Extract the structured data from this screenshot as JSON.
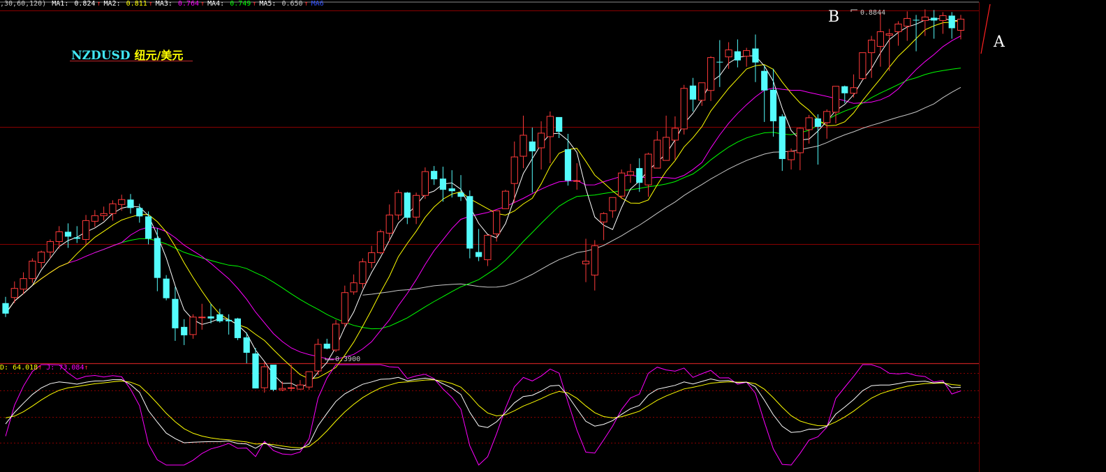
{
  "header": {
    "params": ",30,60,120)",
    "ma": [
      {
        "label": "MA1:",
        "value": "0.824",
        "arrow": "↑",
        "color": "#ffffff"
      },
      {
        "label": "MA2:",
        "value": "0.811",
        "arrow": "↑",
        "color": "#ffff00"
      },
      {
        "label": "MA3:",
        "value": "0.764",
        "arrow": "↑",
        "color": "#ff00ff"
      },
      {
        "label": "MA4:",
        "value": "0.749",
        "arrow": "↑",
        "color": "#00ff00"
      },
      {
        "label": "MA5:",
        "value": "0.650",
        "arrow": "↑",
        "color": "#c8c8c8"
      },
      {
        "label": "MA6",
        "value": "",
        "arrow": "",
        "color": "#3050ff"
      }
    ]
  },
  "title": {
    "symbol": "NZDUSD",
    "name": "纽元/美元"
  },
  "annotations": {
    "a": "A",
    "b": "B",
    "high": "0.8844",
    "low": "0.3900"
  },
  "kdj": {
    "d_label": "D:",
    "d_value": "64.018",
    "d_arrow": "↑",
    "j_label": "J:",
    "j_value": "73.084",
    "j_arrow": "↑"
  },
  "colors": {
    "up": "#ff3a3a",
    "down": "#54fcfc",
    "ma1": "#ffffff",
    "ma2": "#ffff00",
    "ma3": "#ff00ff",
    "ma4": "#00ff00",
    "ma5": "#c8c8c8",
    "grid": "#8a0000"
  },
  "chart_data": {
    "type": "candlestick",
    "title": "NZDUSD 纽元/美元",
    "ylim": [
      0.39,
      0.8844
    ],
    "candles": [
      [
        0.468,
        0.477,
        0.448,
        0.453
      ],
      [
        0.476,
        0.499,
        0.468,
        0.489
      ],
      [
        0.488,
        0.512,
        0.481,
        0.503
      ],
      [
        0.503,
        0.532,
        0.497,
        0.528
      ],
      [
        0.526,
        0.543,
        0.518,
        0.541
      ],
      [
        0.541,
        0.559,
        0.532,
        0.556
      ],
      [
        0.556,
        0.578,
        0.546,
        0.57
      ],
      [
        0.57,
        0.582,
        0.547,
        0.563
      ],
      [
        0.562,
        0.578,
        0.554,
        0.56
      ],
      [
        0.559,
        0.594,
        0.552,
        0.586
      ],
      [
        0.585,
        0.601,
        0.577,
        0.593
      ],
      [
        0.593,
        0.606,
        0.586,
        0.596
      ],
      [
        0.596,
        0.615,
        0.586,
        0.61
      ],
      [
        0.609,
        0.623,
        0.6,
        0.616
      ],
      [
        0.616,
        0.624,
        0.596,
        0.604
      ],
      [
        0.604,
        0.61,
        0.583,
        0.592
      ],
      [
        0.592,
        0.599,
        0.552,
        0.56
      ],
      [
        0.561,
        0.575,
        0.485,
        0.504
      ],
      [
        0.503,
        0.508,
        0.472,
        0.475
      ],
      [
        0.474,
        0.491,
        0.414,
        0.432
      ],
      [
        0.434,
        0.445,
        0.408,
        0.422
      ],
      [
        0.423,
        0.452,
        0.417,
        0.448
      ],
      [
        0.447,
        0.467,
        0.43,
        0.448
      ],
      [
        0.449,
        0.467,
        0.439,
        0.446
      ],
      [
        0.452,
        0.46,
        0.44,
        0.442
      ],
      [
        0.444,
        0.452,
        0.423,
        0.442
      ],
      [
        0.446,
        0.447,
        0.415,
        0.418
      ],
      [
        0.419,
        0.426,
        0.382,
        0.397
      ],
      [
        0.396,
        0.404,
        0.346,
        0.346
      ],
      [
        0.347,
        0.384,
        0.34,
        0.377
      ],
      [
        0.38,
        0.38,
        0.342,
        0.344
      ],
      [
        0.344,
        0.356,
        0.342,
        0.346
      ],
      [
        0.346,
        0.38,
        0.342,
        0.347
      ],
      [
        0.345,
        0.358,
        0.344,
        0.351
      ],
      [
        0.348,
        0.367,
        0.344,
        0.37
      ],
      [
        0.371,
        0.417,
        0.365,
        0.409
      ],
      [
        0.41,
        0.417,
        0.402,
        0.403
      ],
      [
        0.401,
        0.444,
        0.398,
        0.438
      ],
      [
        0.439,
        0.493,
        0.434,
        0.483
      ],
      [
        0.484,
        0.509,
        0.48,
        0.497
      ],
      [
        0.496,
        0.532,
        0.489,
        0.527
      ],
      [
        0.526,
        0.55,
        0.518,
        0.54
      ],
      [
        0.54,
        0.573,
        0.538,
        0.57
      ],
      [
        0.568,
        0.609,
        0.556,
        0.594
      ],
      [
        0.594,
        0.63,
        0.587,
        0.626
      ],
      [
        0.626,
        0.627,
        0.581,
        0.59
      ],
      [
        0.591,
        0.626,
        0.581,
        0.622
      ],
      [
        0.622,
        0.662,
        0.617,
        0.656
      ],
      [
        0.657,
        0.664,
        0.637,
        0.645
      ],
      [
        0.646,
        0.663,
        0.613,
        0.63
      ],
      [
        0.632,
        0.658,
        0.619,
        0.628
      ],
      [
        0.626,
        0.651,
        0.614,
        0.62
      ],
      [
        0.621,
        0.629,
        0.532,
        0.546
      ],
      [
        0.541,
        0.574,
        0.528,
        0.534
      ],
      [
        0.53,
        0.565,
        0.521,
        0.565
      ],
      [
        0.567,
        0.6,
        0.556,
        0.6
      ],
      [
        0.603,
        0.63,
        0.607,
        0.628
      ],
      [
        0.639,
        0.699,
        0.611,
        0.677
      ],
      [
        0.678,
        0.736,
        0.661,
        0.708
      ],
      [
        0.699,
        0.719,
        0.626,
        0.685
      ],
      [
        0.69,
        0.728,
        0.659,
        0.711
      ],
      [
        0.706,
        0.742,
        0.668,
        0.735
      ],
      [
        0.734,
        0.726,
        0.704,
        0.713
      ],
      [
        0.688,
        0.71,
        0.636,
        0.643
      ],
      [
        0.643,
        0.668,
        0.63,
        0.643
      ],
      [
        0.524,
        0.56,
        0.498,
        0.528
      ],
      [
        0.508,
        0.558,
        0.486,
        0.55
      ],
      [
        0.584,
        0.598,
        0.558,
        0.596
      ],
      [
        0.6,
        0.619,
        0.59,
        0.619
      ],
      [
        0.621,
        0.659,
        0.617,
        0.654
      ],
      [
        0.651,
        0.667,
        0.64,
        0.656
      ],
      [
        0.661,
        0.675,
        0.627,
        0.64
      ],
      [
        0.637,
        0.683,
        0.62,
        0.681
      ],
      [
        0.661,
        0.714,
        0.665,
        0.701
      ],
      [
        0.672,
        0.736,
        0.674,
        0.705
      ],
      [
        0.701,
        0.735,
        0.673,
        0.718
      ],
      [
        0.717,
        0.78,
        0.709,
        0.775
      ],
      [
        0.779,
        0.79,
        0.742,
        0.759
      ],
      [
        0.758,
        0.783,
        0.75,
        0.783
      ],
      [
        0.772,
        0.821,
        0.757,
        0.819
      ],
      [
        0.813,
        0.844,
        0.777,
        0.812
      ],
      [
        0.82,
        0.841,
        0.803,
        0.83
      ],
      [
        0.828,
        0.845,
        0.805,
        0.815
      ],
      [
        0.821,
        0.833,
        0.806,
        0.829
      ],
      [
        0.832,
        0.852,
        0.784,
        0.812
      ],
      [
        0.8,
        0.808,
        0.727,
        0.772
      ],
      [
        0.773,
        0.803,
        0.706,
        0.728
      ],
      [
        0.735,
        0.738,
        0.657,
        0.674
      ],
      [
        0.673,
        0.689,
        0.659,
        0.685
      ],
      [
        0.683,
        0.719,
        0.658,
        0.718
      ],
      [
        0.716,
        0.737,
        0.696,
        0.733
      ],
      [
        0.732,
        0.738,
        0.666,
        0.72
      ],
      [
        0.726,
        0.745,
        0.703,
        0.742
      ],
      [
        0.741,
        0.778,
        0.725,
        0.778
      ],
      [
        0.778,
        0.779,
        0.754,
        0.768
      ],
      [
        0.768,
        0.795,
        0.762,
        0.776
      ],
      [
        0.789,
        0.826,
        0.787,
        0.826
      ],
      [
        0.826,
        0.85,
        0.79,
        0.844
      ],
      [
        0.835,
        0.884,
        0.806,
        0.856
      ],
      [
        0.851,
        0.86,
        0.8,
        0.853
      ],
      [
        0.856,
        0.871,
        0.836,
        0.867
      ],
      [
        0.864,
        0.885,
        0.843,
        0.875
      ],
      [
        0.873,
        0.88,
        0.828,
        0.872
      ],
      [
        0.872,
        0.888,
        0.85,
        0.877
      ],
      [
        0.876,
        0.887,
        0.846,
        0.872
      ],
      [
        0.872,
        0.884,
        0.853,
        0.879
      ],
      [
        0.879,
        0.884,
        0.846,
        0.861
      ],
      [
        0.858,
        0.88,
        0.845,
        0.874
      ]
    ]
  }
}
